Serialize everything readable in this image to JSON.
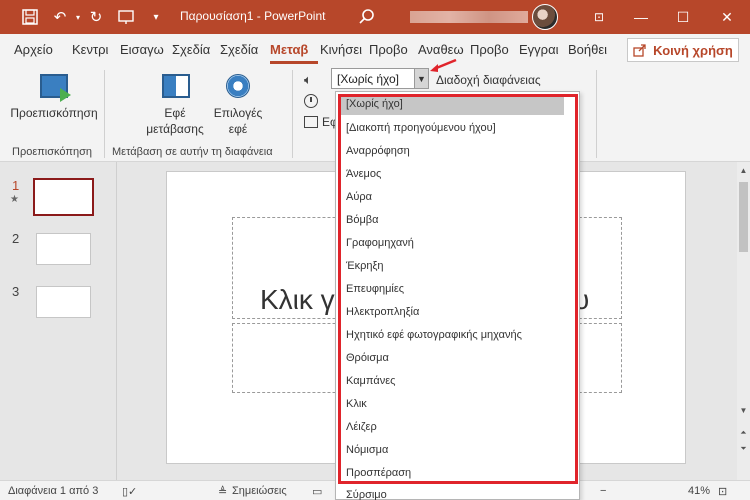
{
  "titlebar": {
    "doc_title": "Παρουσίαση1 - PowerPoint",
    "save_icon": "save-icon",
    "undo_icon": "undo-icon",
    "redo_icon": "redo-icon",
    "present_icon": "present-icon",
    "customize_icon": "customize-icon",
    "search_icon": "search-icon",
    "account_icon": "account-blur",
    "buttons": {
      "minimize": "—",
      "restore": "☐",
      "close": "✕"
    },
    "accent": "#b7472a"
  },
  "tabs": [
    {
      "label": "Αρχείο"
    },
    {
      "label": "Κεντρι"
    },
    {
      "label": "Εισαγω"
    },
    {
      "label": "Σχεδία"
    },
    {
      "label": "Σχεδία"
    },
    {
      "label": "Μεταβ"
    },
    {
      "label": "Κινήσει"
    },
    {
      "label": "Προβο"
    },
    {
      "label": "Αναθεω"
    },
    {
      "label": "Προβο"
    },
    {
      "label": "Εγγραι"
    },
    {
      "label": "Βοήθει"
    }
  ],
  "share": {
    "label": "Κοινή χρήση"
  },
  "ribbon": {
    "preview_label": "Προεπισκόπηση",
    "preview_group": "Προεπισκόπηση",
    "effects_label_1": "Εφέ",
    "effects_label_2": "μετάβασης",
    "options_label_1": "Επιλογές",
    "options_label_2": "εφέ",
    "transition_group": "Μετάβαση σε αυτήν τη διαφάνεια",
    "apply_label": "Εφ",
    "sound_value": "[Χωρίς ήχο]",
    "slide_advance_label": "Διαδοχή διαφάνειας"
  },
  "slides": {
    "numbers": [
      "1",
      "2",
      "3"
    ],
    "star": "★",
    "title_text": "Κλικ γ",
    "title_tail": "υ"
  },
  "statusbar": {
    "slide_info": "Διαφάνεια 1 από 3",
    "notes_label": "Σημειώσεις",
    "zoom": "41%"
  },
  "dropdown": {
    "items": [
      "[Χωρίς ήχο]",
      "[Διακοπή προηγούμενου ήχου]",
      "Αναρρόφηση",
      "Άνεμος",
      "Αύρα",
      "Βόμβα",
      "Γραφομηχανή",
      "Έκρηξη",
      "Επευφημίες",
      "Ηλεκτροπληξία",
      "Ηχητικό εφέ φωτογραφικής μηχανής",
      "Θρόισμα",
      "Καμπάνες",
      "Κλικ",
      "Λέιζερ",
      "Νόμισμα",
      "Προσπέραση",
      "Σύρσιμο"
    ],
    "highlight": "#e0242b"
  }
}
